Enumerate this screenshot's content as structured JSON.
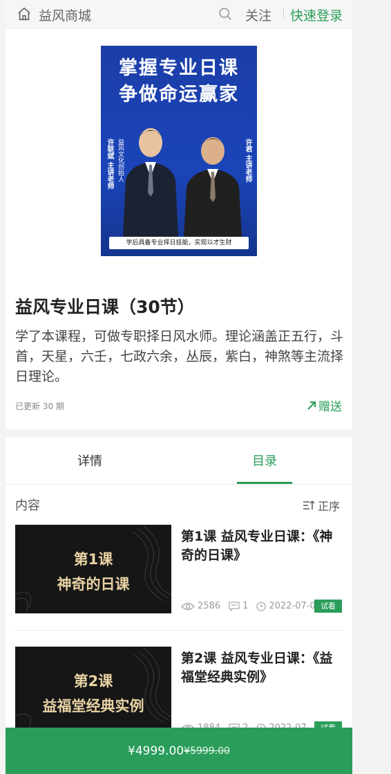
{
  "header": {
    "shop_name": "益风商城",
    "follow": "关注",
    "login": "快速登录"
  },
  "course": {
    "poster": {
      "title_line1": "掌握专业日课",
      "title_line2": "争做命运赢家",
      "left_teacher": "许联斌 主讲老师",
      "left_org": "益风文化创始人",
      "right_teacher": "许君 主讲老师",
      "tagline": "学后具备专业择日技能，实现以才生财"
    },
    "title": "益风专业日课（30节）",
    "description": "学了本课程，可做专职择日风水师。理论涵盖正五行，斗首，天星，六壬，七政六余，丛辰，紫白，神煞等主流择日理论。",
    "updated": "已更新 30 期",
    "gift": "赠送"
  },
  "tabs": [
    {
      "label": "详情",
      "active": false
    },
    {
      "label": "目录",
      "active": true
    }
  ],
  "catalog": {
    "label": "内容",
    "sort": "正序",
    "lessons": [
      {
        "thumb_line1": "第1课",
        "thumb_line2": "神奇的日课",
        "title": "第1课 益风专业日课：《神奇的日课》",
        "views": "2586",
        "comments": "1",
        "date": "2022-07-0",
        "badge": "试看"
      },
      {
        "thumb_line1": "第2课",
        "thumb_line2": "益福堂经典实例",
        "title": "第2课 益风专业日课：《益福堂经典实例》",
        "views": "1884",
        "comments": "2",
        "date": "2022-07-",
        "badge": "试看"
      }
    ]
  },
  "buy_bar": {
    "price": "¥4999.00",
    "original_price": "¥5999.00"
  },
  "colors": {
    "accent": "#2a9d5a",
    "poster_blue": "#1a44b8",
    "thumb_bg": "#161616",
    "thumb_text": "#e8d2a4"
  }
}
